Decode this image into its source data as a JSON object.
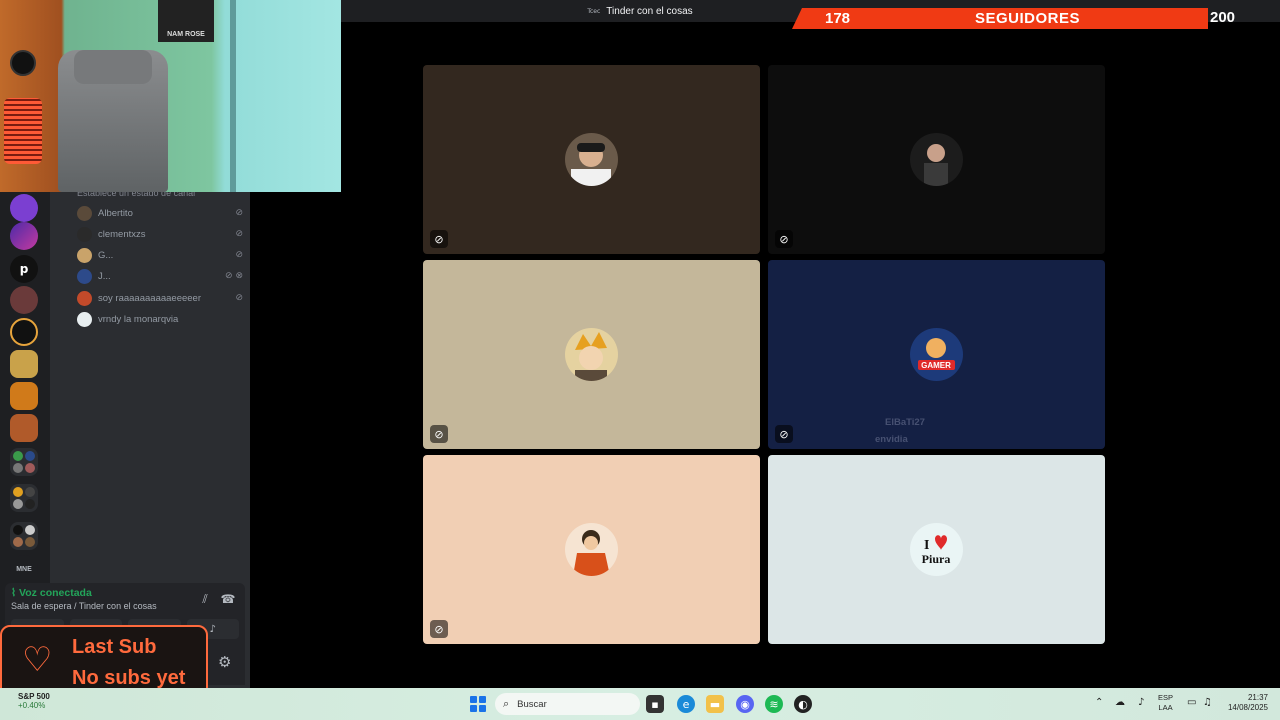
{
  "window": {
    "title": "Tinder con el cosas",
    "title_icon": "Tcec"
  },
  "followers": {
    "current": "178",
    "label": "SEGUIDORES",
    "goal": "200"
  },
  "members": [
    {
      "name": "Albertito",
      "avatar_color": "#5a4a3a",
      "icons": "⊘"
    },
    {
      "name": "clementxzs",
      "avatar_color": "#2a2a2a",
      "icons": "⊘"
    },
    {
      "name": "G...",
      "avatar_color": "#c9a36a",
      "icons": "⊘"
    },
    {
      "name": "J...",
      "avatar_color": "#2d4a8a",
      "icons": "⊘ ⊗"
    },
    {
      "name": "soy raaaaaaaaaaeeeeer",
      "avatar_color": "#c24a2a",
      "icons": "⊘"
    },
    {
      "name": "vrndy la monarqvia",
      "avatar_color": "#e8eef0",
      "icons": ""
    }
  ],
  "status_hint": "Establece un estado de canal",
  "voice": {
    "status": "Voz conectada",
    "room": "Sala de espera / Tinder con el cosas"
  },
  "tiles": [
    {
      "bg": "#33281f",
      "muted": true,
      "avatar_bg": "#6a5a4a",
      "ghost_name": "",
      "ghost_sub": ""
    },
    {
      "bg": "#0d0d0d",
      "muted": true,
      "avatar_bg": "#1c1c1c",
      "ghost_name": "",
      "ghost_sub": ""
    },
    {
      "bg": "#c4b79a",
      "muted": true,
      "avatar_bg": "#e5d2a0",
      "ghost_name": "",
      "ghost_sub": ""
    },
    {
      "bg": "#142044",
      "muted": true,
      "avatar_bg": "#1d3a7a",
      "ghost_name": "ElBaTi27",
      "ghost_sub": "envidia"
    },
    {
      "bg": "#f1cfb4",
      "muted": true,
      "avatar_bg": "#f6e4d2",
      "ghost_name": "",
      "ghost_sub": ""
    },
    {
      "bg": "#dce6e7",
      "muted": false,
      "avatar_bg": "#eaf5f5",
      "ghost_name": "",
      "ghost_sub": ""
    }
  ],
  "avatar_labels": {
    "gamer": "GAMER",
    "love_i": "I",
    "love_city": "Piura"
  },
  "webcam": {
    "poster_text": "NAM ROSE"
  },
  "last_sub": {
    "title": "Last Sub",
    "value": "No subs yet"
  },
  "taskbar": {
    "stock_name": "S&P 500",
    "stock_change": "+0.40%",
    "search_placeholder": "Buscar",
    "lang": "ESP",
    "lang_sub": "LAA",
    "time": "21:37",
    "date": "14/08/2025"
  }
}
